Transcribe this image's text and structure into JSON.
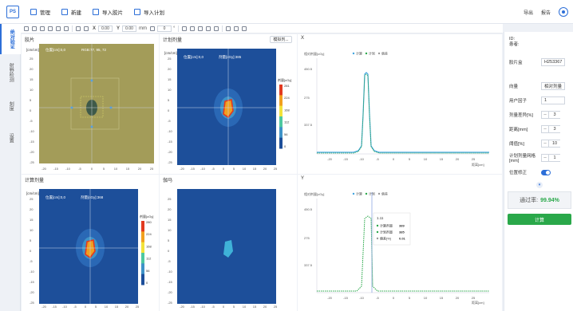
{
  "app": {
    "logo": "PS"
  },
  "menu": [
    {
      "label": "管理",
      "icon": "folder-icon"
    },
    {
      "label": "新建",
      "icon": "new-file-icon"
    },
    {
      "label": "导入胶片",
      "icon": "import-film-icon"
    },
    {
      "label": "导入计划",
      "icon": "import-plan-icon"
    }
  ],
  "topright": {
    "export": "导出",
    "report": "报告"
  },
  "nav": [
    {
      "label": "绝对验证",
      "active": true
    },
    {
      "label": "射野检测",
      "active": false
    },
    {
      "label": "刻度",
      "active": false
    },
    {
      "label": "设置",
      "active": false
    }
  ],
  "toolbar": {
    "x_label": "X",
    "x_value": "0.00",
    "y_label": "Y",
    "y_value": "0.00",
    "unit": "mm",
    "angle_value": "0",
    "angle_unit": "°"
  },
  "panels": {
    "film": {
      "title": "胶片",
      "unit": "[cm/cm]",
      "pos": "位置[cm]:0,0",
      "rgb": "RGB:77, 95, 72"
    },
    "plan": {
      "title": "计划剂量",
      "unit": "[cm/cm]",
      "dropdown": "模拟剂...",
      "pos": "位置[cm]:0,0",
      "dose": "剂量[cGy]:385",
      "legend_title": "剂量[cGy]",
      "legend": [
        "281",
        "224",
        "168",
        "112",
        "56",
        "0"
      ]
    },
    "xprof": {
      "title": "X",
      "ylabel": "相对剂量[cGy]",
      "xlabel": "距离[cm]",
      "legend": [
        "计算",
        "计划",
        "偏差"
      ],
      "yticks": [
        "450.5",
        "275",
        "337.5"
      ]
    },
    "calc": {
      "title": "计算剂量",
      "unit": "[cm/cm]",
      "pos": "位置[cm]:0,0",
      "dose": "剂量[cGy]:368",
      "legend_title": "剂量[cGy]",
      "legend": [
        "280",
        "224",
        "168",
        "112",
        "56",
        "0"
      ]
    },
    "gamma": {
      "title": "伽马"
    },
    "yprof": {
      "title": "Y",
      "ylabel": "相对剂量[cGy]",
      "xlabel": "距离[cm]",
      "legend": [
        "计算",
        "计划",
        "偏差"
      ],
      "yticks": [
        "450.5",
        "275",
        "337.5"
      ],
      "tooltip": {
        "pos": "1.11",
        "rows": [
          {
            "label": "计算剂量",
            "value": "389"
          },
          {
            "label": "计划剂量",
            "value": "385"
          },
          {
            "label": "偏差[%]",
            "value": "0.01"
          }
        ]
      }
    }
  },
  "axis_ticks": [
    "-20",
    "-15",
    "-10",
    "-5",
    "0",
    "5",
    "10",
    "15",
    "20",
    "25"
  ],
  "axis_yticks": [
    "25",
    "20",
    "15",
    "10",
    "5",
    "0",
    "-5",
    "-10",
    "-15",
    "-20",
    "-25"
  ],
  "right": {
    "id_label": "ID:",
    "name_label": "患者:",
    "rows": [
      {
        "label": "胶片盒",
        "value": "H253367"
      },
      {
        "label": "向量",
        "value": "相对剂量"
      },
      {
        "label": "用户因子",
        "value": "1"
      }
    ],
    "steppers": [
      {
        "label": "剂量差异[%]",
        "value": "3"
      },
      {
        "label": "距离[mm]",
        "value": "3"
      },
      {
        "label": "阈值[%]",
        "value": "10"
      },
      {
        "label": "计划剂量网格[mm]",
        "value": "1"
      }
    ],
    "pos_label": "位置修正",
    "pass_label": "通过率:",
    "pass_value": "99.94%",
    "calc_label": "计算"
  }
}
